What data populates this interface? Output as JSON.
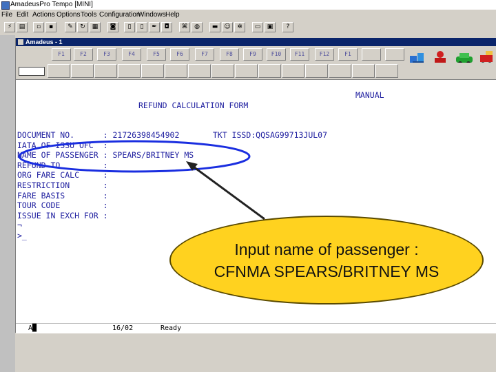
{
  "window": {
    "title": "AmadeusPro Tempo [MINI]"
  },
  "menu": [
    "File",
    "Edit",
    "Actions",
    "Options",
    "Tools",
    "Configuration",
    "Windows",
    "Help"
  ],
  "inner_window": {
    "title": "Amadeus - 1"
  },
  "function_keys": [
    "F1",
    "F2",
    "F3",
    "F4",
    "F5",
    "F6",
    "F7",
    "F8",
    "F9",
    "F10",
    "F11",
    "F12",
    "F1"
  ],
  "screen": {
    "mode": "MANUAL",
    "form_title": "REFUND CALCULATION FORM",
    "lines": [
      "DOCUMENT NO.      : 21726398454902       TKT ISSD:QQSAG99713JUL07",
      "IATA OF ISSU OFC  :",
      "NAME OF PASSENGER : SPEARS/BRITNEY MS",
      "REFUND TO         :",
      "ORG FARE CALC     :",
      "RESTRICTION       :",
      "FARE BASIS        :",
      "TOUR CODE         :",
      "ISSUE IN EXCH FOR :",
      "¬",
      ">_"
    ]
  },
  "status_bar": {
    "field_a": "A█",
    "field_pos": "16/02",
    "field_status": "Ready"
  },
  "callout": {
    "line1": "Input name of passenger :",
    "line2": "CFNMA SPEARS/BRITNEY MS"
  },
  "colors": {
    "terminal_text": "#2020a0",
    "highlight_ellipse": "#1a2ee0",
    "callout_fill": "#ffd21f",
    "title_bar": "#0a246a"
  }
}
